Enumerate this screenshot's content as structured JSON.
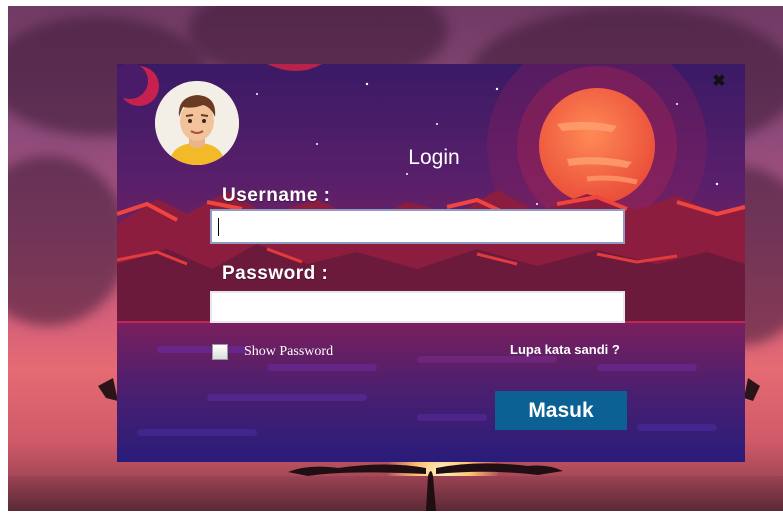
{
  "dialog": {
    "close_glyph": "✖",
    "title": "Login",
    "username_label": "Username :",
    "username_value": "",
    "password_label": "Password :",
    "password_value": "",
    "show_password_label": "Show Password",
    "show_password_checked": false,
    "forgot_password_label": "Lupa kata sandi ?",
    "login_button_label": "Masuk"
  },
  "icons": {
    "avatar": "user-avatar-icon",
    "close": "close-icon"
  },
  "colors": {
    "login_button": "#0b6193",
    "dialog_top": "#3a1a66",
    "dialog_bottom": "#2a1a78",
    "moon": "#f06a45"
  }
}
